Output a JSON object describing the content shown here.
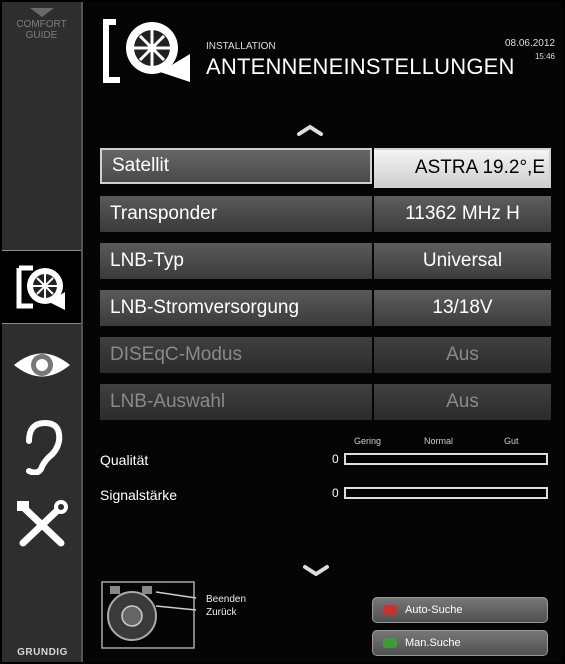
{
  "sidebar": {
    "comfort_guide": "COMFORT GUIDE",
    "brand": "GRUNDIG",
    "items": [
      {
        "icon": "satellite-dish-icon",
        "active": true
      },
      {
        "icon": "eye-icon",
        "active": false
      },
      {
        "icon": "ear-icon",
        "active": false
      },
      {
        "icon": "tools-icon",
        "active": false
      }
    ]
  },
  "header": {
    "section": "INSTALLATION",
    "title": "ANTENNENEINSTELLUNGEN",
    "date": "08.06.2012",
    "time": "15:46",
    "icon": "satellite-dish-icon"
  },
  "settings": [
    {
      "label": "Satellit",
      "value": "ASTRA 19.2°,E",
      "selected": true,
      "enabled": true
    },
    {
      "label": "Transponder",
      "value": "11362 MHz H",
      "selected": false,
      "enabled": true
    },
    {
      "label": "LNB-Typ",
      "value": "Universal",
      "selected": false,
      "enabled": true
    },
    {
      "label": "LNB-Stromversorgung",
      "value": "13/18V",
      "selected": false,
      "enabled": true
    },
    {
      "label": "DISEqC-Modus",
      "value": "Aus",
      "selected": false,
      "enabled": false
    },
    {
      "label": "LNB-Auswahl",
      "value": "Aus",
      "selected": false,
      "enabled": false
    }
  ],
  "meters": {
    "scale": [
      "Gering",
      "Normal",
      "Gut"
    ],
    "quality": {
      "label": "Qualität",
      "value_text": "0",
      "level": 0
    },
    "signal": {
      "label": "Signalstärke",
      "value_text": "0",
      "level": 0
    }
  },
  "hints": {
    "exit": "Beenden",
    "back": "Zurück"
  },
  "buttons": [
    {
      "label": "Auto-Suche",
      "key_color": "#c8312d"
    },
    {
      "label": "Man.Suche",
      "key_color": "#3e9a3a"
    }
  ],
  "colors": {
    "selected_value_bg": "#f4f4f4",
    "row_bg": "#4a4a4a",
    "disabled_text": "#8a8a8a"
  }
}
